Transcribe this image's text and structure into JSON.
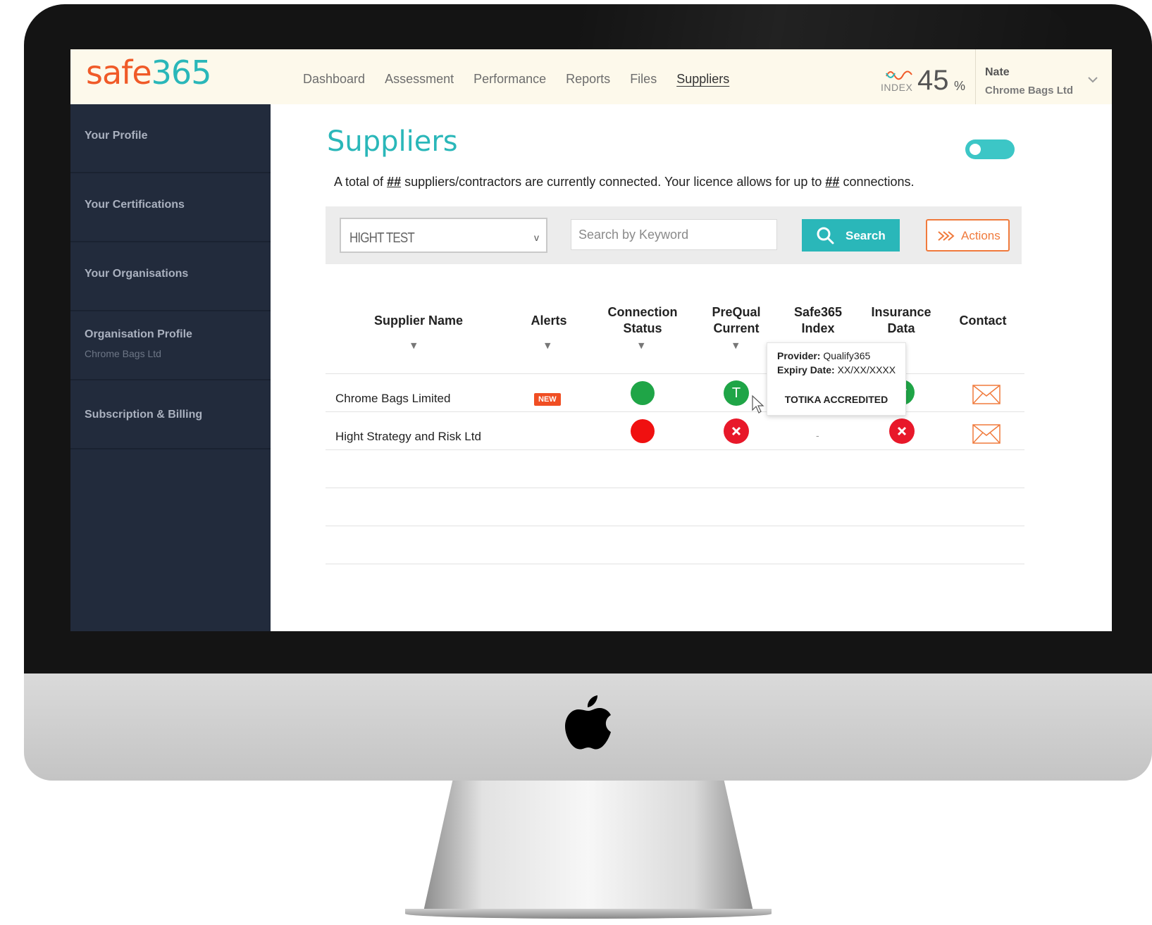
{
  "brand": {
    "logo_part1": "safe",
    "logo_part2": "365",
    "logo_colors": {
      "safe": "#f05a28",
      "num": "#2ab7b9"
    }
  },
  "nav": {
    "items": [
      "Dashboard",
      "Assessment",
      "Performance",
      "Reports",
      "Files",
      "Suppliers"
    ],
    "active": "Suppliers"
  },
  "index": {
    "word": "INDEX",
    "value": "45",
    "unit": "%"
  },
  "user": {
    "name": "Nate",
    "org": "Chrome Bags Ltd"
  },
  "sidebar": {
    "items": [
      {
        "label": "Your Profile"
      },
      {
        "label": "Your Certifications"
      },
      {
        "label": "Your Organisations"
      },
      {
        "label": "Organisation Profile",
        "sub": "Chrome Bags Ltd"
      },
      {
        "label": "Subscription & Billing"
      }
    ]
  },
  "page": {
    "title": "Suppliers",
    "summary_prefix": "A total of ",
    "summary_count": "##",
    "summary_middle": " suppliers/contractors are currently connected. Your licence allows for up to ",
    "summary_limit": "##",
    "summary_suffix": " connections.",
    "toggle_on": true
  },
  "filters": {
    "select_value": "HIGHT TEST",
    "search_placeholder": "Search by Keyword",
    "search_label": "Search",
    "actions_label": "Actions"
  },
  "table": {
    "columns": [
      {
        "label": "Supplier Name"
      },
      {
        "label": "Alerts"
      },
      {
        "label": "Connection",
        "label2": "Status"
      },
      {
        "label": "PreQual",
        "label2": "Current"
      },
      {
        "label": "Safe365",
        "label2": "Index"
      },
      {
        "label": "Insurance",
        "label2": "Data"
      },
      {
        "label": "Contact"
      }
    ],
    "rows": [
      {
        "name": "Chrome Bags Limited",
        "alert": "NEW",
        "connection": "green",
        "prequal": "T",
        "index": "",
        "insurance": "check"
      },
      {
        "name": "Hight Strategy and Risk Ltd",
        "alert": "",
        "connection": "red",
        "prequal": "x",
        "index": "-",
        "insurance": "x"
      }
    ]
  },
  "tooltip": {
    "provider_label": "Provider:",
    "provider_value": "Qualify365",
    "expiry_label": "Expiry Date:",
    "expiry_value": "XX/XX/XXXX",
    "status": "TOTIKA ACCREDITED"
  }
}
